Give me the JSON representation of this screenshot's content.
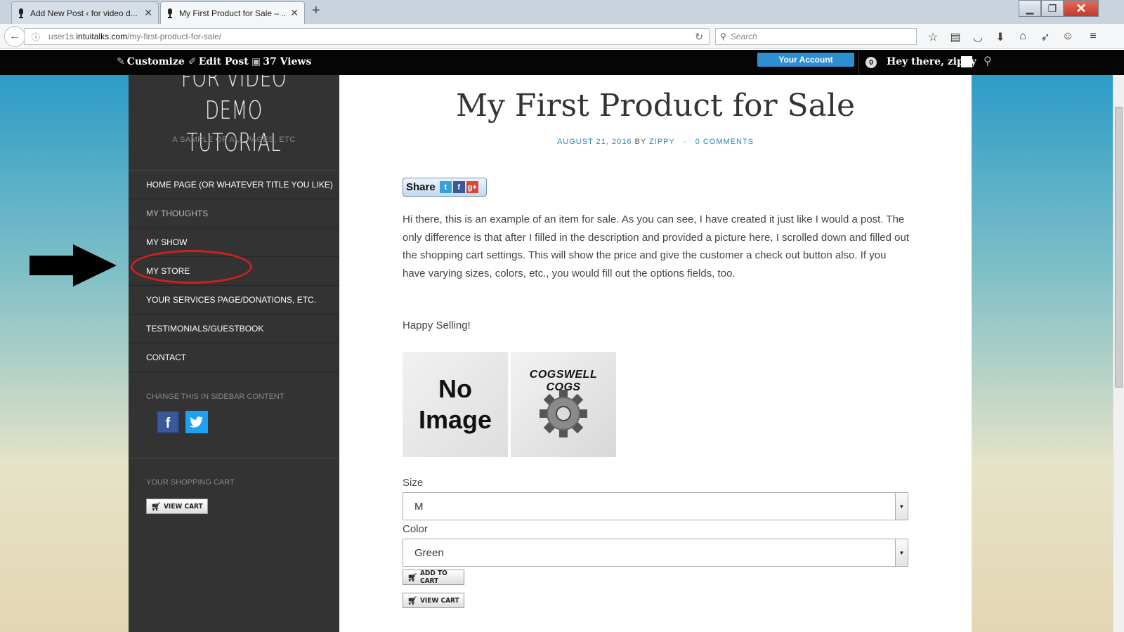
{
  "browser": {
    "tabs": [
      {
        "label": "Add New Post ‹ for video d...",
        "active": false
      },
      {
        "label": "My First Product for Sale – ...",
        "active": true
      }
    ],
    "url": {
      "prefix": "user1s.",
      "domain": "intuitalks.com",
      "path": "/my-first-product-for-sale/"
    },
    "search_placeholder": "Search"
  },
  "admin_bar": {
    "customize": "Customize",
    "edit_post": "Edit Post",
    "views": "37 Views",
    "account": "Your Account",
    "count": "0",
    "greeting": "Hey there, zippy"
  },
  "sidebar": {
    "site_title_line1": "FOR VIDEO DEMO",
    "site_title_line2": "TUTORIAL",
    "tagline": "A SAMPLE OF ALL PAGES, ETC",
    "menu": [
      {
        "label": "HOME PAGE (OR WHATEVER TITLE YOU LIKE)"
      },
      {
        "label": "MY THOUGHTS"
      },
      {
        "label": "MY SHOW"
      },
      {
        "label": "MY STORE"
      },
      {
        "label": "YOUR SERVICES PAGE/DONATIONS, ETC."
      },
      {
        "label": "TESTIMONIALS/GUESTBOOK"
      },
      {
        "label": "CONTACT"
      }
    ],
    "widget_social_title": "CHANGE THIS IN SIDEBAR CONTENT",
    "widget_cart_title": "YOUR SHOPPING CART",
    "view_cart": "VIEW CART"
  },
  "post": {
    "title": "My First Product for Sale",
    "date": "AUGUST 21, 2016",
    "by": "BY",
    "author": "ZIPPY",
    "dot": "·",
    "comments": "0 COMMENTS",
    "share_label": "Share",
    "body": "Hi there, this is an example of an item for sale. As you can see, I have created it just like I would a post. The only difference is that after I filled in the description and provided a picture here, I scrolled down and filled out the shopping cart settings. This will show the price and give the customer a check out button also. If you have varying sizes, colors, etc., you would fill out the options fields, too.",
    "happy_selling": "Happy Selling!",
    "no_image_line1": "No",
    "no_image_line2": "Image",
    "cogs_text": "COGSWELL COGS",
    "size_label": "Size",
    "size_value": "M",
    "color_label": "Color",
    "color_value": "Green",
    "add_to_cart": "ADD TO CART",
    "view_cart": "VIEW CART"
  },
  "colors": {
    "admin_bar": "#050505",
    "sidebar": "#333333",
    "link": "#2a86b7",
    "annotation_red": "#d21f1f"
  }
}
